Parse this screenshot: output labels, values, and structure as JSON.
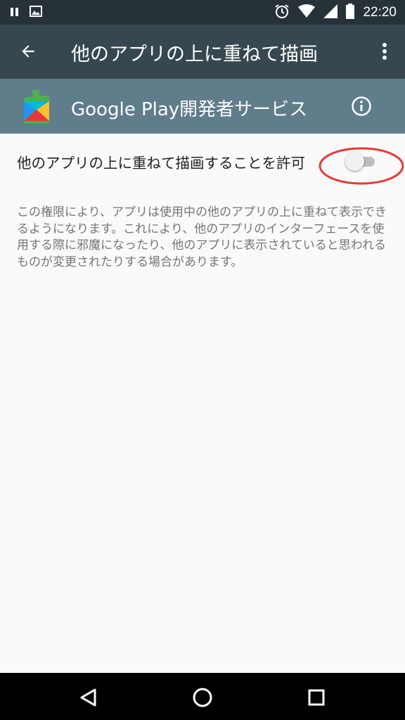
{
  "status_bar": {
    "time": "22:20",
    "icons": [
      "pause-icon",
      "image-notification-icon",
      "alarm-icon",
      "wifi-icon",
      "cellular-signal-icon",
      "battery-icon"
    ]
  },
  "app_bar": {
    "title": "他のアプリの上に重ねて描画",
    "background": "#37474f"
  },
  "app_header": {
    "app_name": "Google Play開発者サービス",
    "background": "#607d8b"
  },
  "setting": {
    "label": "他のアプリの上に重ねて描画することを許可",
    "toggle_state": "off"
  },
  "description": "この権限により、アプリは使用中の他のアプリの上に重ねて表示できるようになります。これにより、他のアプリのインターフェースを使用する際に邪魔になったり、他のアプリに表示されていると思われるものが変更されたりする場合があります。",
  "annotation": {
    "color": "#e53935"
  },
  "nav_bar": {
    "buttons": [
      "back-icon",
      "home-icon",
      "recents-icon"
    ]
  }
}
